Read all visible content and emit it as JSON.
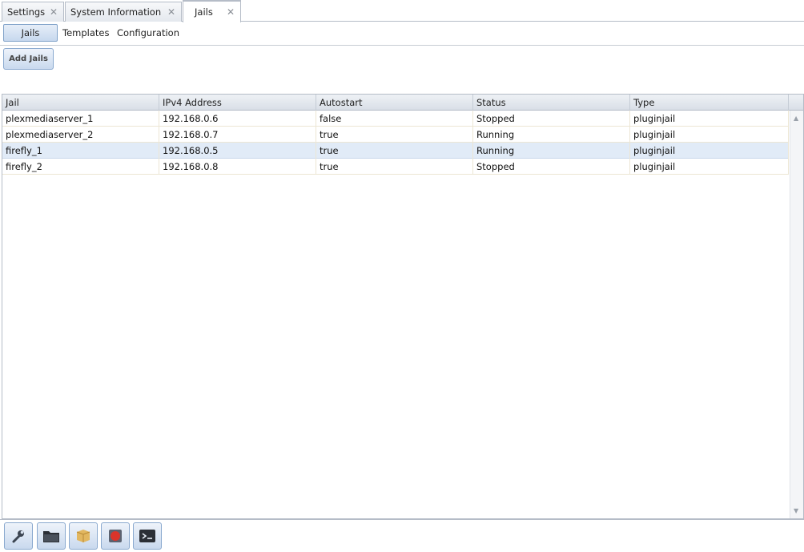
{
  "tabs": [
    {
      "label": "Settings"
    },
    {
      "label": "System Information"
    },
    {
      "label": "Jails"
    }
  ],
  "subtabs": {
    "jails": "Jails",
    "templates": "Templates",
    "configuration": "Configuration"
  },
  "toolbar": {
    "add_jails": "Add Jails"
  },
  "grid": {
    "columns": [
      "Jail",
      "IPv4 Address",
      "Autostart",
      "Status",
      "Type"
    ],
    "rows": [
      [
        "plexmediaserver_1",
        "192.168.0.6",
        "false",
        "Stopped",
        "pluginjail"
      ],
      [
        "plexmediaserver_2",
        "192.168.0.7",
        "true",
        "Running",
        "pluginjail"
      ],
      [
        "firefly_1",
        "192.168.0.5",
        "true",
        "Running",
        "pluginjail"
      ],
      [
        "firefly_2",
        "192.168.0.8",
        "true",
        "Stopped",
        "pluginjail"
      ]
    ],
    "selected_row": 2
  },
  "bottom_icons": [
    "wrench-icon",
    "folder-icon",
    "package-icon",
    "stop-icon",
    "console-icon"
  ],
  "colors": {
    "accent_border": "#8aa9cf",
    "selected_row": "#e1ebf7"
  }
}
